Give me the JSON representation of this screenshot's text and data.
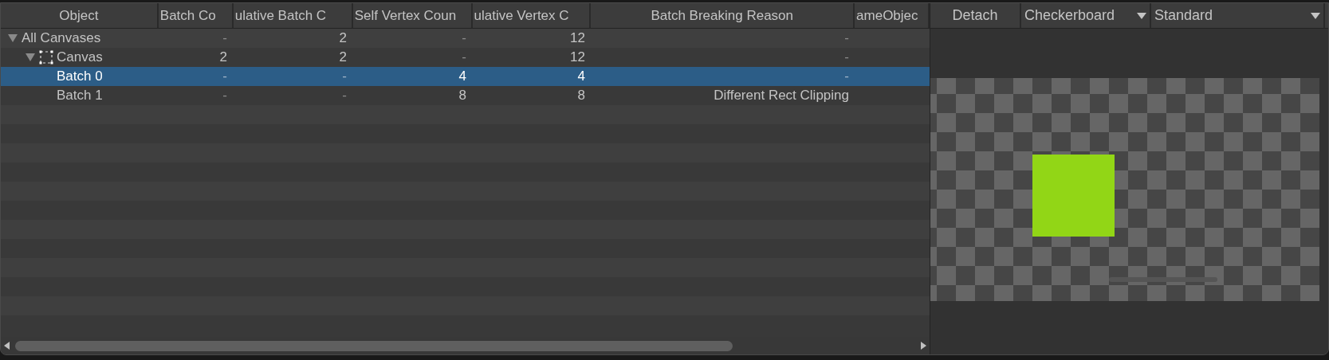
{
  "columns": [
    {
      "label": "Object"
    },
    {
      "label": "Batch Co"
    },
    {
      "label": "ulative Batch C"
    },
    {
      "label": "Self Vertex Coun"
    },
    {
      "label": "ulative Vertex C"
    },
    {
      "label": "Batch Breaking Reason"
    },
    {
      "label": "ameObjec"
    }
  ],
  "rows": [
    {
      "name": "All Canvases",
      "expanded": true,
      "selected": false,
      "cells": [
        "-",
        "2",
        "-",
        "12",
        "-"
      ],
      "children": [
        {
          "name": "Canvas",
          "kind": "canvas",
          "expanded": true,
          "selected": false,
          "cells": [
            "2",
            "2",
            "-",
            "12",
            "-"
          ],
          "children": [
            {
              "name": "Batch 0",
              "selected": true,
              "cells": [
                "-",
                "-",
                "4",
                "4",
                "-"
              ]
            },
            {
              "name": "Batch 1",
              "selected": false,
              "cells": [
                "-",
                "-",
                "8",
                "8",
                "Different Rect Clipping"
              ]
            }
          ]
        }
      ]
    }
  ],
  "preview_toolbar": {
    "detach_button": "Detach",
    "background_dropdown": "Checkerboard",
    "material_dropdown": "Standard"
  }
}
